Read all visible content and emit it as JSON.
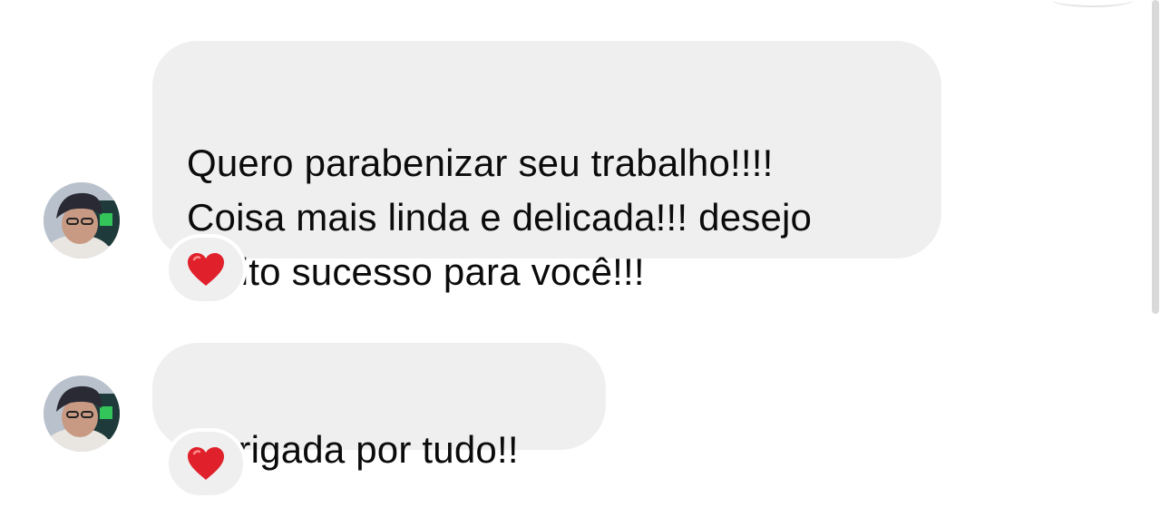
{
  "thread": {
    "messages": [
      {
        "text": "Quero parabenizar seu trabalho!!!!\nCoisa mais linda e delicada!!! desejo\nmuito sucesso para você!!!",
        "reaction_icon": "red-heart-icon",
        "reaction_color": "#e0202a"
      },
      {
        "text": "Obrigada por tudo!!",
        "reaction_icon": "red-heart-icon",
        "reaction_color": "#e0202a"
      }
    ],
    "bubble_color": "#efefef"
  }
}
